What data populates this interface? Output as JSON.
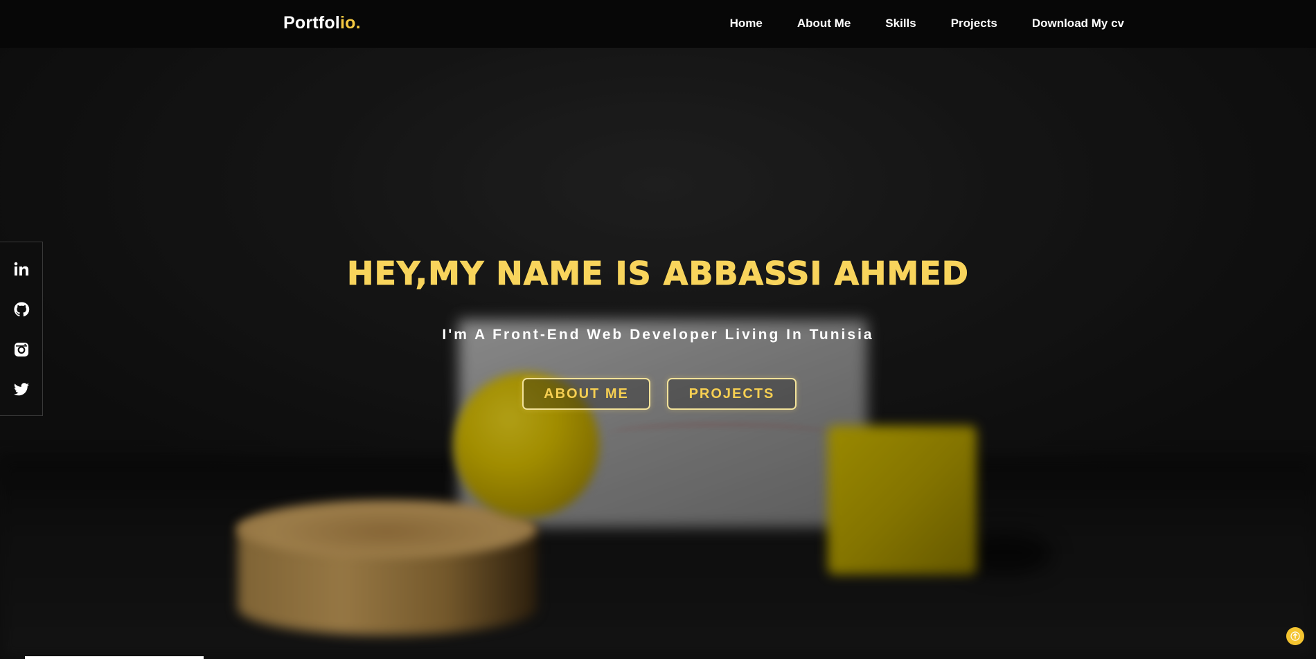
{
  "navbar": {
    "logo_main": "Portfol",
    "logo_accent": "io.",
    "links": [
      {
        "label": "Home"
      },
      {
        "label": "About Me"
      },
      {
        "label": "Skills"
      },
      {
        "label": "Projects"
      },
      {
        "label": "Download My cv"
      }
    ]
  },
  "social": {
    "icons": [
      "linkedin-icon",
      "github-icon",
      "instagram-icon",
      "twitter-icon"
    ]
  },
  "hero": {
    "title": "HEY,MY NAME IS ABBASSI AHMED",
    "subtitle": "I'm A Front-End Web Developer Living In Tunisia",
    "buttons": {
      "about_label": "ABOUT ME",
      "projects_label": "PROJECTS"
    }
  },
  "colors": {
    "accent": "#f8d45c",
    "navbar_bg": "#070707",
    "text": "#ffffff"
  },
  "scroll_top_icon": "arrow-up-icon"
}
